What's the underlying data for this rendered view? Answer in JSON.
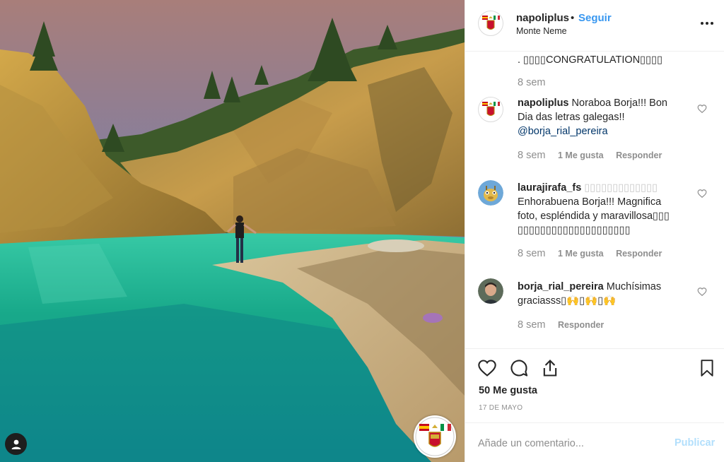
{
  "post": {
    "author": "napoliplus",
    "follow_separator": "•",
    "follow_label": "Seguir",
    "location": "Monte Neme",
    "more_icon": "more-options-icon"
  },
  "comments": [
    {
      "text": ". ▯▯▯▯CONGRATULATION▯▯▯▯",
      "time": "8 sem"
    },
    {
      "user": "napoliplus",
      "text": "Noraboa Borja!!! Bon Dia das letras galegas!!",
      "mention": "@borja_rial_pereira",
      "time": "8 sem",
      "likes": "1 Me gusta",
      "reply": "Responder"
    },
    {
      "user": "laurajirafa_fs",
      "text_prefix": "▯▯▯▯▯▯▯▯▯▯▯▯▯",
      "text": "Enhorabuena Borja!!! Magnifica foto, espléndida y maravillosa▯▯▯ ▯▯▯▯▯▯▯▯▯▯▯▯▯▯▯▯▯▯▯▯",
      "time": "8 sem",
      "likes": "1 Me gusta",
      "reply": "Responder"
    },
    {
      "user": "borja_rial_pereira",
      "text": "Muchísimas graciasss▯🙌▯🙌▯🙌",
      "time": "8 sem",
      "reply": "Responder"
    }
  ],
  "actions": {
    "like_icon": "heart-icon",
    "comment_icon": "comment-icon",
    "share_icon": "share-icon",
    "save_icon": "bookmark-icon"
  },
  "likes_text": "50 Me gusta",
  "date_text": "17 DE MAYO",
  "add_comment": {
    "placeholder": "Añade un comentario...",
    "publish_label": "Publicar"
  },
  "colors": {
    "link_blue": "#3897f0",
    "publish_disabled": "#b2dffc",
    "muted": "#8e8e8e"
  }
}
